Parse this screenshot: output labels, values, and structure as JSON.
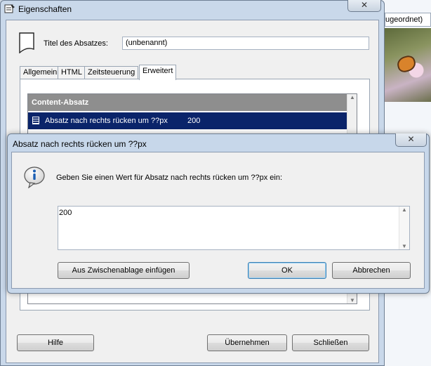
{
  "background": {
    "tab_text": "ugeordnet)"
  },
  "main_dialog": {
    "title": "Eigenschaften",
    "close_glyph": "✕",
    "title_label": "Titel des Absatzes:",
    "title_value": "(unbenannt)",
    "tabs": [
      {
        "label": "Allgemein"
      },
      {
        "label": "HTML"
      },
      {
        "label": "Zeitsteuerung"
      },
      {
        "label": "Erweitert"
      }
    ],
    "group_header": "Content-Absatz",
    "selected_row": {
      "label": "Absatz nach rechts rücken um ??px",
      "value": "200"
    },
    "buttons": {
      "help": "Hilfe",
      "apply": "Übernehmen",
      "close": "Schließen"
    }
  },
  "modal": {
    "title": "Absatz nach rechts rücken um ??px",
    "close_glyph": "✕",
    "prompt": "Geben Sie einen Wert für Absatz nach rechts rücken um ??px ein:",
    "value": "200",
    "buttons": {
      "paste": "Aus Zwischenablage einfügen",
      "ok": "OK",
      "cancel": "Abbrechen"
    }
  },
  "colors": {
    "selection": "#0a246a",
    "group_header": "#8e8e8e",
    "window_frame": "#c9d8ea"
  },
  "icons": {
    "window": "properties-icon",
    "paragraph": "document-icon",
    "info": "info-bubble-icon"
  }
}
